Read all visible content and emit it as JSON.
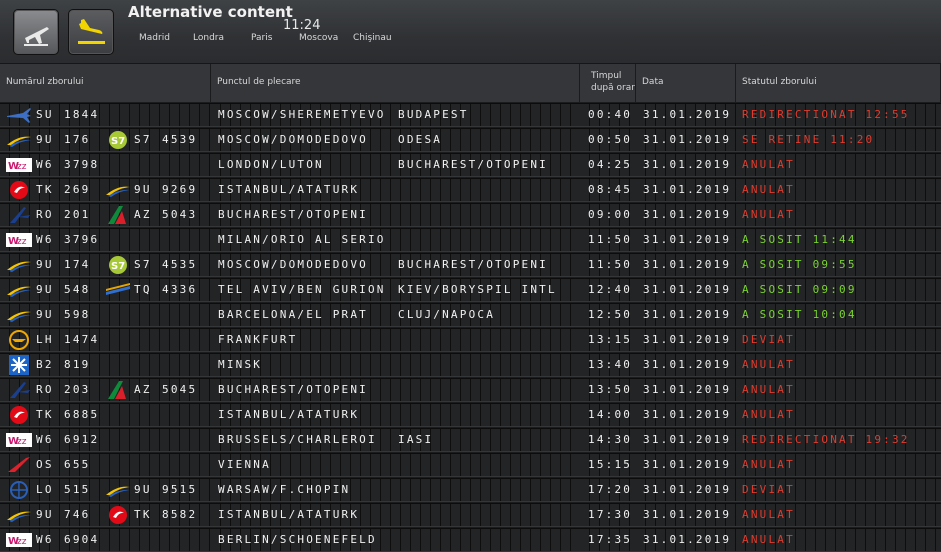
{
  "header": {
    "title": "Alternative content",
    "time": "11:24",
    "cities": [
      "Madrid",
      "Londra",
      "Paris",
      "Moscova",
      "Chişinau"
    ]
  },
  "columns": {
    "flight": "Numărul zborului",
    "origin": "Punctul de plecare",
    "time": [
      "Timpul",
      "după orar"
    ],
    "date": "Data",
    "status": "Statutul zborului"
  },
  "colors": {
    "status_red": "#e23b2d",
    "status_green": "#7bd42f"
  },
  "flights": [
    {
      "logo": "sukhoi-plane-icon",
      "code": "SU",
      "number": "1844",
      "co_logo": "",
      "co_code": "",
      "co_number": "",
      "origin": "MOSCOW/SHEREMETYEVO",
      "via": "BUDAPEST",
      "time": "00:40",
      "date": "31.01.2019",
      "status": "REDIRECTIONAT 12:55",
      "status_color": "red"
    },
    {
      "logo": "ukraine-airlines-icon",
      "code": "9U",
      "number": "176",
      "co_logo": "s7-icon",
      "co_code": "S7",
      "co_number": "4539",
      "origin": "MOSCOW/DOMODEDOVO",
      "via": "ODESA",
      "time": "00:50",
      "date": "31.01.2019",
      "status": "SE RETINE 11:20",
      "status_color": "red"
    },
    {
      "logo": "wizz-icon",
      "code": "W6",
      "number": "3798",
      "co_logo": "",
      "co_code": "",
      "co_number": "",
      "origin": "LONDON/LUTON",
      "via": "BUCHAREST/OTOPENI",
      "time": "04:25",
      "date": "31.01.2019",
      "status": "ANULAT",
      "status_color": "red"
    },
    {
      "logo": "turkish-icon",
      "code": "TK",
      "number": "269",
      "co_logo": "ukraine-airlines-icon",
      "co_code": "9U",
      "co_number": "9269",
      "origin": "ISTANBUL/ATATURK",
      "via": "",
      "time": "08:45",
      "date": "31.01.2019",
      "status": "ANULAT",
      "status_color": "red"
    },
    {
      "logo": "tarom-icon",
      "code": "RO",
      "number": "201",
      "co_logo": "alitalia-icon",
      "co_code": "AZ",
      "co_number": "5043",
      "origin": "BUCHAREST/OTOPENI",
      "via": "",
      "time": "09:00",
      "date": "31.01.2019",
      "status": "ANULAT",
      "status_color": "red"
    },
    {
      "logo": "wizz-icon",
      "code": "W6",
      "number": "3796",
      "co_logo": "",
      "co_code": "",
      "co_number": "",
      "origin": "MILAN/ORIO AL SERIO",
      "via": "",
      "time": "11:50",
      "date": "31.01.2019",
      "status": "A SOSIT 11:44",
      "status_color": "green"
    },
    {
      "logo": "ukraine-airlines-icon",
      "code": "9U",
      "number": "174",
      "co_logo": "s7-icon",
      "co_code": "S7",
      "co_number": "4535",
      "origin": "MOSCOW/DOMODEDOVO",
      "via": "BUCHAREST/OTOPENI",
      "time": "11:50",
      "date": "31.01.2019",
      "status": "A SOSIT 09:55",
      "status_color": "green"
    },
    {
      "logo": "ukraine-airlines-icon",
      "code": "9U",
      "number": "548",
      "co_logo": "tarom-stripe-icon",
      "co_code": "TQ",
      "co_number": "4336",
      "origin": "TEL AVIV/BEN GURION",
      "via": "KIEV/BORYSPIL INTL",
      "time": "12:40",
      "date": "31.01.2019",
      "status": "A SOSIT 09:09",
      "status_color": "green"
    },
    {
      "logo": "ukraine-airlines-icon",
      "code": "9U",
      "number": "598",
      "co_logo": "",
      "co_code": "",
      "co_number": "",
      "origin": "BARCELONA/EL PRAT",
      "via": "CLUJ/NAPOCA",
      "time": "12:50",
      "date": "31.01.2019",
      "status": "A SOSIT 10:04",
      "status_color": "green"
    },
    {
      "logo": "lufthansa-icon",
      "code": "LH",
      "number": "1474",
      "co_logo": "",
      "co_code": "",
      "co_number": "",
      "origin": "FRANKFURT",
      "via": "",
      "time": "13:15",
      "date": "31.01.2019",
      "status": "DEVIAT",
      "status_color": "red"
    },
    {
      "logo": "belavia-icon",
      "code": "B2",
      "number": "819",
      "co_logo": "",
      "co_code": "",
      "co_number": "",
      "origin": "MINSK",
      "via": "",
      "time": "13:40",
      "date": "31.01.2019",
      "status": "ANULAT",
      "status_color": "red"
    },
    {
      "logo": "tarom-icon",
      "code": "RO",
      "number": "203",
      "co_logo": "alitalia-icon",
      "co_code": "AZ",
      "co_number": "5045",
      "origin": "BUCHAREST/OTOPENI",
      "via": "",
      "time": "13:50",
      "date": "31.01.2019",
      "status": "ANULAT",
      "status_color": "red"
    },
    {
      "logo": "turkish-icon",
      "code": "TK",
      "number": "6885",
      "co_logo": "",
      "co_code": "",
      "co_number": "",
      "origin": "ISTANBUL/ATATURK",
      "via": "",
      "time": "14:00",
      "date": "31.01.2019",
      "status": "ANULAT",
      "status_color": "red"
    },
    {
      "logo": "wizz-icon",
      "code": "W6",
      "number": "6912",
      "co_logo": "",
      "co_code": "",
      "co_number": "",
      "origin": "BRUSSELS/CHARLEROI",
      "via": "IASI",
      "time": "14:30",
      "date": "31.01.2019",
      "status": "REDIRECTIONAT 19:32",
      "status_color": "red"
    },
    {
      "logo": "austrian-icon",
      "code": "OS",
      "number": "655",
      "co_logo": "",
      "co_code": "",
      "co_number": "",
      "origin": "VIENNA",
      "via": "",
      "time": "15:15",
      "date": "31.01.2019",
      "status": "ANULAT",
      "status_color": "red"
    },
    {
      "logo": "lot-icon",
      "code": "LO",
      "number": "515",
      "co_logo": "ukraine-airlines-icon",
      "co_code": "9U",
      "co_number": "9515",
      "origin": "WARSAW/F.CHOPIN",
      "via": "",
      "time": "17:20",
      "date": "31.01.2019",
      "status": "DEVIAT",
      "status_color": "red"
    },
    {
      "logo": "ukraine-airlines-icon",
      "code": "9U",
      "number": "746",
      "co_logo": "turkish-icon",
      "co_code": "TK",
      "co_number": "8582",
      "origin": "ISTANBUL/ATATURK",
      "via": "",
      "time": "17:30",
      "date": "31.01.2019",
      "status": "ANULAT",
      "status_color": "red"
    },
    {
      "logo": "wizz-icon",
      "code": "W6",
      "number": "6904",
      "co_logo": "",
      "co_code": "",
      "co_number": "",
      "origin": "BERLIN/SCHOENEFELD",
      "via": "",
      "time": "17:35",
      "date": "31.01.2019",
      "status": "ANULAT",
      "status_color": "red"
    }
  ]
}
